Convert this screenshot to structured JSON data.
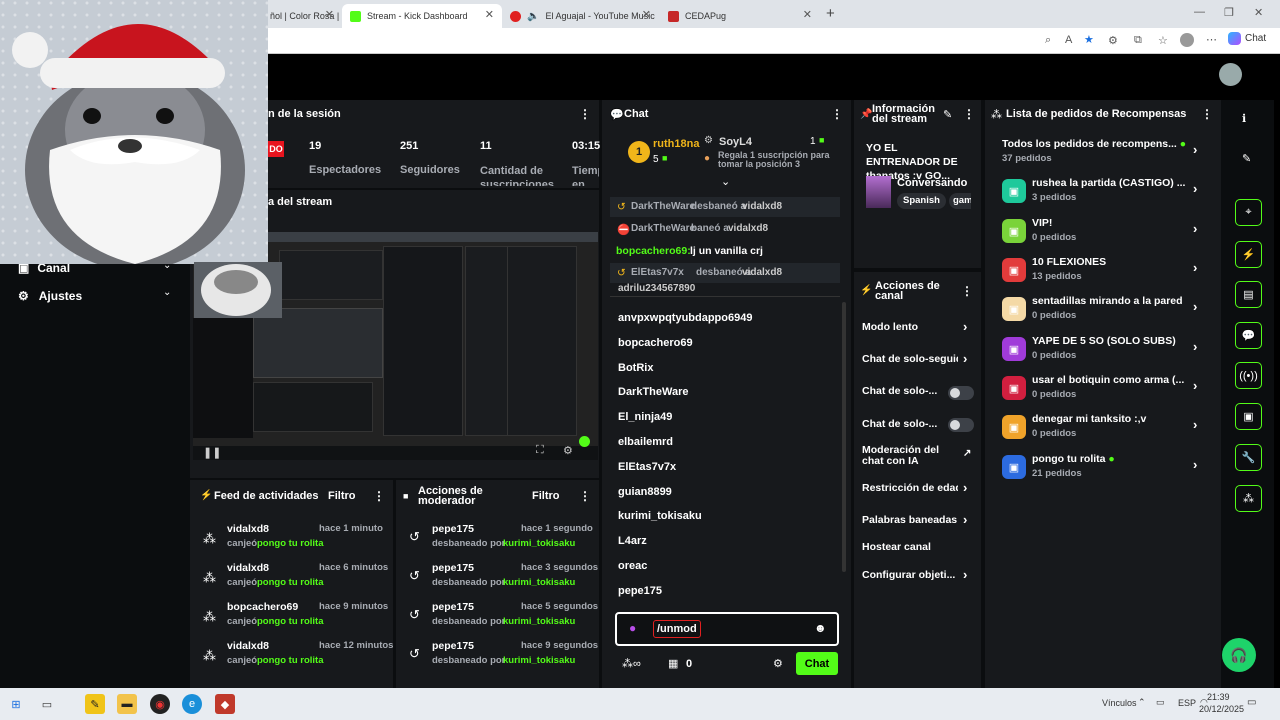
{
  "browser": {
    "tabs": [
      {
        "label": "ñol | Color Rosa | Kick",
        "active": false
      },
      {
        "label": "Stream - Kick Dashboard",
        "active": true
      },
      {
        "label": "El Aguajal - YouTube Music",
        "active": false
      },
      {
        "label": "CEDAPug",
        "active": false
      }
    ],
    "new_tab": "+",
    "chat_button": "Chat"
  },
  "overlay": {
    "name": "cat-santa-webcam"
  },
  "left_nav": {
    "canal": "Canal",
    "ajustes": "Ajustes"
  },
  "session": {
    "title": "n de la sesión",
    "live_badge": "DO",
    "stats": [
      {
        "value": "19",
        "label": "Espectadores"
      },
      {
        "value": "251",
        "label": "Seguidores"
      },
      {
        "value": "11",
        "label": "Cantidad de suscripciones"
      },
      {
        "value": "03:15",
        "label": "Tiemp en vivo"
      }
    ]
  },
  "preview": {
    "title": "a del stream"
  },
  "feed": {
    "title": "Feed de actividades",
    "filter": "Filtro",
    "items": [
      {
        "user": "vidalxd8",
        "time": "hace 1 minuto",
        "action": "canjeó",
        "reward": "pongo tu rolita"
      },
      {
        "user": "vidalxd8",
        "time": "hace 6 minutos",
        "action": "canjeó",
        "reward": "pongo tu rolita"
      },
      {
        "user": "bopcachero69",
        "time": "hace 9 minutos",
        "action": "canjeó",
        "reward": "pongo tu rolita"
      },
      {
        "user": "vidalxd8",
        "time": "hace 12 minutos",
        "action": "canjeó",
        "reward": "pongo tu rolita"
      }
    ]
  },
  "modactions": {
    "title": "Acciones de moderador",
    "filter": "Filtro",
    "items": [
      {
        "user": "pepe175",
        "time": "hace 1 segundo",
        "action": "desbaneado por",
        "by": "kurimi_tokisaku"
      },
      {
        "user": "pepe175",
        "time": "hace 3 segundos",
        "action": "desbaneado por",
        "by": "kurimi_tokisaku"
      },
      {
        "user": "pepe175",
        "time": "hace 5 segundos",
        "action": "desbaneado por",
        "by": "kurimi_tokisaku"
      },
      {
        "user": "pepe175",
        "time": "hace 9 segundos",
        "action": "desbaneado por",
        "by": "kurimi_tokisaku"
      }
    ]
  },
  "chat": {
    "title": "Chat",
    "leader1": {
      "rank": "1",
      "name": "ruth18na",
      "count": "5"
    },
    "leader2": {
      "name": "SoyL4",
      "count": "1",
      "text": "Regala 1 suscripción para tomar la posición 3"
    },
    "messages": [
      {
        "user": "DarkTheWare",
        "text": "desbaneó a",
        "target": "vidalxd8"
      },
      {
        "user": "DarkTheWare",
        "text": "baneó a",
        "target": "vidalxd8"
      },
      {
        "user": "bopcachero69:",
        "text": "lj un vanilla crj",
        "target": ""
      },
      {
        "user": "ElEtas7v7x",
        "text": "desbaneó a",
        "target": "vidalxd8"
      }
    ],
    "partial": "adrilu234567890",
    "users": [
      "anvpxwpqtyubdappo6949",
      "bopcachero69",
      "BotRix",
      "DarkTheWare",
      "El_ninja49",
      "elbailemrd",
      "ElEtas7v7x",
      "guian8899",
      "kurimi_tokisaku",
      "L4arz",
      "oreac",
      "pepe175"
    ],
    "input_value": "/unmod",
    "points": "0",
    "send": "Chat"
  },
  "info": {
    "title": "Información del stream",
    "stream_title": "YO EL ENTRENADOR DE thanatos :v GO...",
    "category": "Conversando",
    "tags": [
      "Spanish",
      "gam"
    ]
  },
  "channel_actions": {
    "title": "Acciones de canal",
    "items": [
      "Modo lento",
      "Chat de solo-seguid",
      "Chat de solo-...",
      "Chat de solo-...",
      "Moderación del chat con IA",
      "Restricción de edad",
      "Palabras baneadas",
      "Hostear canal",
      "Configurar objeti..."
    ]
  },
  "rewards": {
    "title": "Lista de pedidos de Recompensas",
    "items": [
      {
        "name": "Todos los pedidos de recompens...",
        "count": "37 pedidos",
        "color": "",
        "dot": true
      },
      {
        "name": "rushea la partida (CASTIGO) ...",
        "count": "3 pedidos",
        "color": "#1ec99b",
        "dot": false
      },
      {
        "name": "VIP!",
        "count": "0 pedidos",
        "color": "#7ad33a",
        "dot": false
      },
      {
        "name": "10 FLEXIONES",
        "count": "13 pedidos",
        "color": "#e23b3b",
        "dot": false
      },
      {
        "name": "sentadillas mirando a la pared",
        "count": "0 pedidos",
        "color": "#f4d9a6",
        "dot": false
      },
      {
        "name": "YAPE DE 5 SO (SOLO SUBS)",
        "count": "0 pedidos",
        "color": "#a03bd9",
        "dot": false
      },
      {
        "name": "usar el botiquin como arma (...",
        "count": "0 pedidos",
        "color": "#d21f3f",
        "dot": false
      },
      {
        "name": "denegar mi tanksito :,v",
        "count": "0 pedidos",
        "color": "#f0a32a",
        "dot": false
      },
      {
        "name": "pongo tu rolita",
        "count": "21 pedidos",
        "color": "#2c6be0",
        "dot": true
      }
    ]
  },
  "taskbar": {
    "vinculos": "Vínculos",
    "lang": "ESP",
    "time": "21:39",
    "date": "20/12/2025"
  }
}
